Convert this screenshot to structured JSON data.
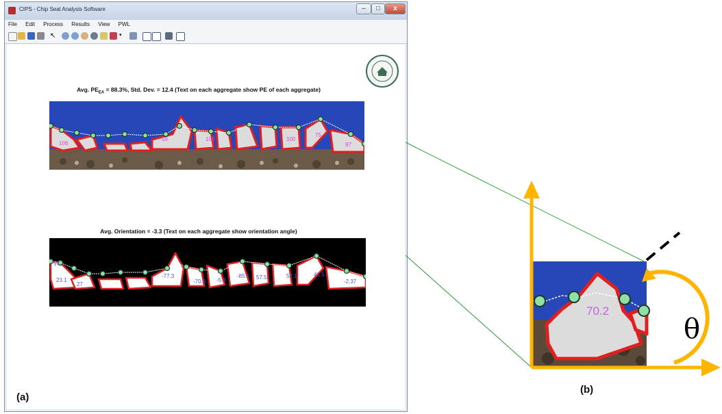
{
  "window": {
    "title": "CIPS - Chip Seal Analysis Software",
    "controls": [
      "minimize-icon",
      "maximize-icon",
      "close-icon"
    ]
  },
  "menu": [
    "File",
    "Edit",
    "Process",
    "Results",
    "View",
    "PWL"
  ],
  "toolbar_icons": [
    "new-icon",
    "open-icon",
    "save-icon",
    "print-icon",
    "pointer-icon",
    "zoom-in-icon",
    "zoom-out-icon",
    "pan-icon",
    "rotate-icon",
    "datacursor-icon",
    "brush-icon",
    "dropdown-icon",
    "link-icon",
    "colorbar-icon",
    "legend-icon",
    "hide-tools-icon",
    "show-tools-icon"
  ],
  "seal_text": [
    "MICHIGAN STATE",
    "UNIVERSITY",
    "Founded",
    "1855"
  ],
  "top_caption": {
    "prefix": "Avg. PE",
    "subscript": "EA",
    "suffix": " = 88.3%, Std. Dev. = 12.4 (Text on each aggregate show PE of each aggregate)"
  },
  "top_labels": [
    "106",
    "59",
    "100",
    "100",
    "75",
    "97"
  ],
  "bottom_caption": "Avg. Orientation = -3.3 (Text on each aggregate show orientation angle)",
  "bottom_labels": [
    "57",
    "23.1",
    "27",
    "-77.3",
    "-70.6",
    "-5.3",
    "-85.1",
    "57.5",
    "52.1",
    "41.5",
    "-2.37"
  ],
  "inset_label": "70.2",
  "theta": "θ",
  "panel_a": "(a)",
  "panel_b": "(b)",
  "colors": {
    "blue_bg": "#2747b8",
    "outline": "#e02020",
    "marker": "#8fe0a8",
    "arrow": "#ffb400",
    "line": "#2a9a3a"
  }
}
